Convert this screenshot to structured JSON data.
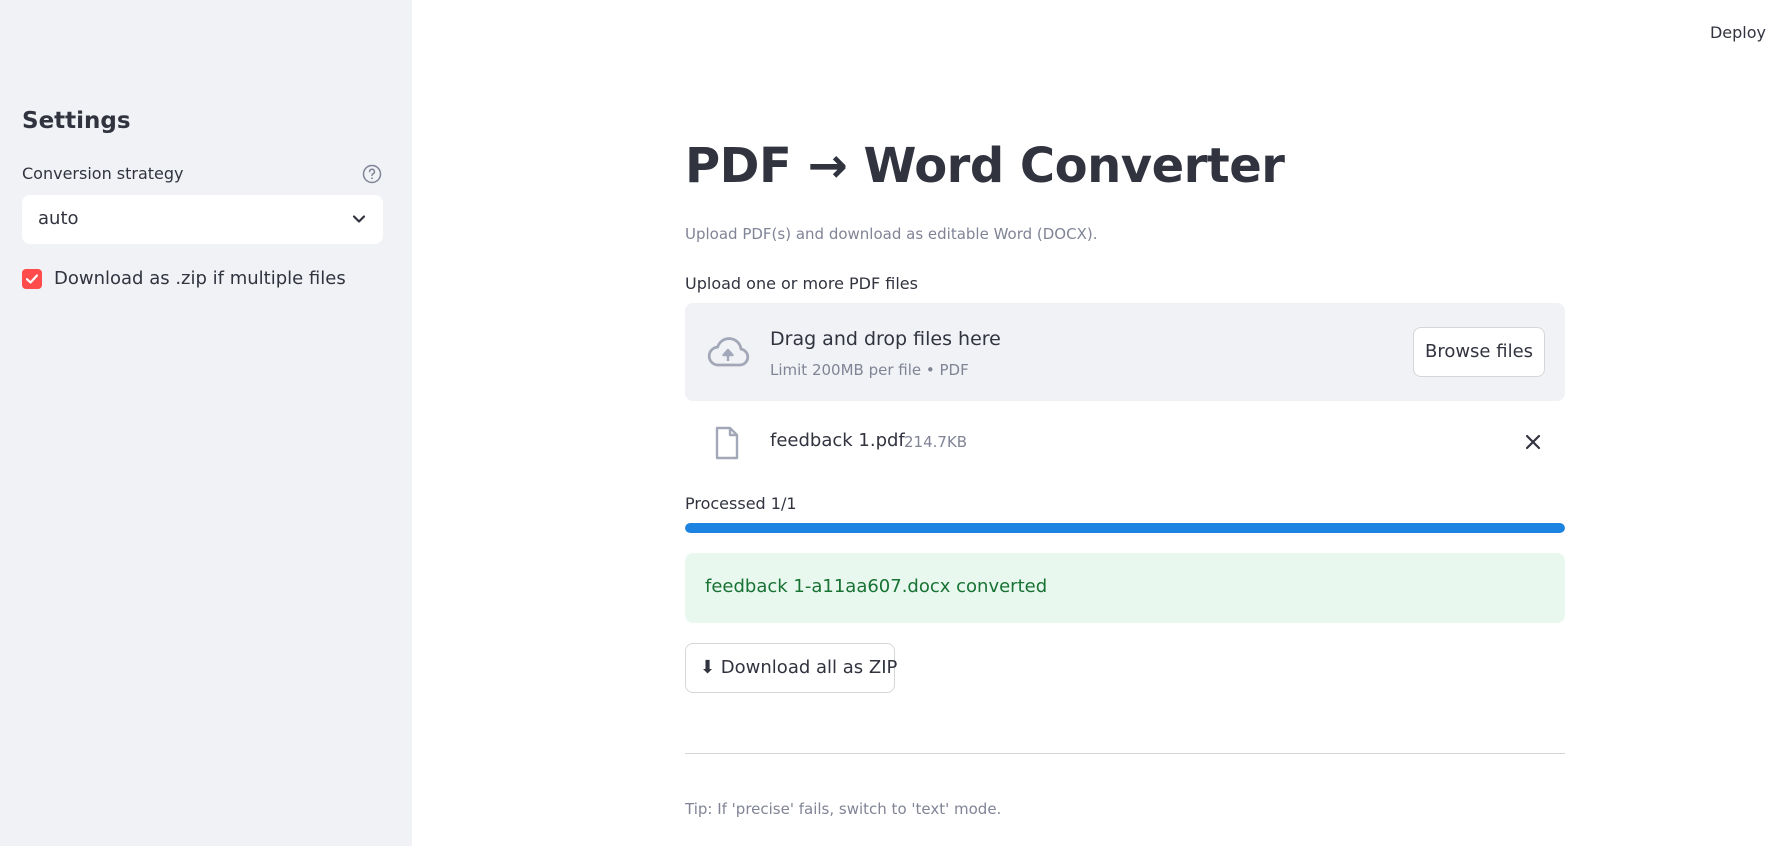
{
  "header": {
    "deploy_label": "Deploy"
  },
  "sidebar": {
    "title": "Settings",
    "strategy_label": "Conversion strategy",
    "strategy_value": "auto",
    "zip_checkbox_label": "Download as .zip if multiple files",
    "zip_checkbox_checked": true
  },
  "main": {
    "title": "PDF → Word Converter",
    "subtitle": "Upload PDF(s) and download as editable Word (DOCX).",
    "uploader": {
      "label": "Upload one or more PDF files",
      "drop_title": "Drag and drop files here",
      "drop_subtitle": "Limit 200MB per file • PDF",
      "browse_label": "Browse files"
    },
    "file": {
      "name": "feedback 1.pdf",
      "size": "214.7KB"
    },
    "progress": {
      "label": "Processed 1/1",
      "fraction": 1.0
    },
    "success_message": "feedback 1-a11aa607.docx converted",
    "download_button_label": "⬇ Download all as ZIP",
    "tip": "Tip: If 'precise' fails, switch to 'text' mode."
  },
  "colors": {
    "accent_red": "#ff4b4b",
    "progress_blue": "#1c83e1",
    "success_bg": "#e8f8ee",
    "success_text": "#177233"
  }
}
